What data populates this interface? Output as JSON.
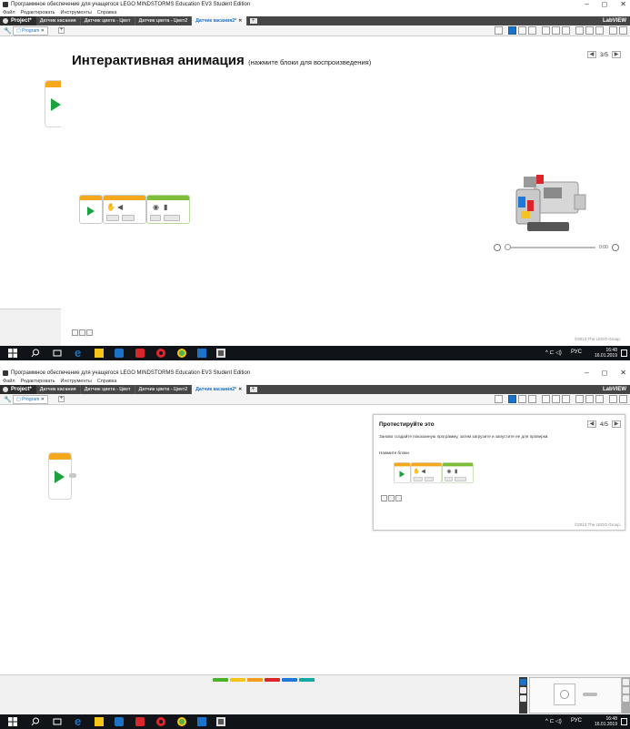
{
  "window": {
    "title": "Программное обеспечение для учащегося LEGO MINDSTORMS Education EV3 Student Edition",
    "controls": [
      "–",
      "◻",
      "✕"
    ]
  },
  "menu": [
    "Файл",
    "Редактировать",
    "Инструменты",
    "Справка"
  ],
  "tabs": {
    "project": "Project*",
    "items": [
      "Датчик касания",
      "Датчик цвета - Цвет",
      "Датчик цвета - Цвет2",
      "Датчик касания2*"
    ],
    "active_index": 3,
    "close_glyph": "✕",
    "add_glyph": "+",
    "right_label": "LabVIEW"
  },
  "program_tab": {
    "label": "Program",
    "close": "✕",
    "add": "+"
  },
  "lesson1": {
    "heading": "Интерактивная анимация",
    "subheading": "(нажмите блоки для воспроизведения)",
    "page": "3/5",
    "prev": "◀",
    "next": "▶",
    "video_time": "0:00",
    "copyright": "©2013 The LEGO Group."
  },
  "lesson2": {
    "title": "Протестируйте это",
    "description": "Заново создайте показанную программу, затем загрузите и запустите ее для проверки.",
    "instruction": "Нажмите блоки.",
    "page": "4/5",
    "prev": "◀",
    "next": "▶",
    "copyright": "©2013 The LEGO Group."
  },
  "taskbar": {
    "time": "16:48",
    "date": "16.01.2019",
    "lang": "РУС",
    "icons": [
      "windows-icon",
      "search-icon",
      "task-view-icon",
      "edge-icon",
      "explorer-icon",
      "store-icon",
      "ev3-icon",
      "opera-icon",
      "chrome-icon",
      "photos-icon",
      "lego-icon"
    ]
  },
  "palette_colors": [
    "#4caf2e",
    "#f5c518",
    "#f29a1c",
    "#d9262a",
    "#1e78d6",
    "#14a9a0"
  ],
  "colors": {
    "accent": "#1a73c8",
    "start_green": "#1aa33e",
    "action_orange": "#f5a81c",
    "sensor_yellow": "#f3c325",
    "sensor_green": "#7dbd3a",
    "tabbar": "#464646"
  }
}
